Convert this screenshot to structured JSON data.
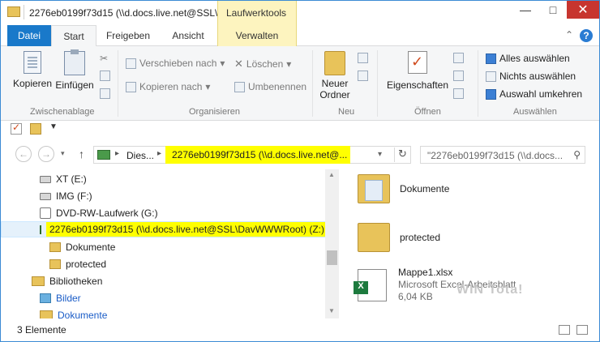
{
  "window": {
    "title": "2276eb0199f73d15 (\\\\d.docs.live.net@SSL\\...",
    "context_tab_header": "Laufwerktools",
    "accent": "#1979ca",
    "highlight": "#ffff00"
  },
  "tabs": [
    {
      "label": "Datei"
    },
    {
      "label": "Start"
    },
    {
      "label": "Freigeben"
    },
    {
      "label": "Ansicht"
    },
    {
      "label": "Verwalten"
    }
  ],
  "ribbon": {
    "clipboard": {
      "copy": "Kopieren",
      "paste": "Einfügen",
      "label": "Zwischenablage"
    },
    "organize": {
      "move": "Verschieben nach",
      "copy_to": "Kopieren nach",
      "delete": "Löschen",
      "rename": "Umbenennen",
      "label": "Organisieren"
    },
    "new": {
      "new_folder_line1": "Neuer",
      "new_folder_line2": "Ordner",
      "label": "Neu"
    },
    "open": {
      "properties": "Eigenschaften",
      "label": "Öffnen"
    },
    "select": {
      "all": "Alles auswählen",
      "none": "Nichts auswählen",
      "invert": "Auswahl umkehren",
      "label": "Auswählen"
    }
  },
  "address": {
    "segment1": "Dies...",
    "segment2": "2276eb0199f73d15 (\\\\d.docs.live.net@...",
    "search_placeholder": "\"2276eb0199f73d15 (\\\\d.docs..."
  },
  "nav_tree": [
    {
      "label": "XT (E:)",
      "icon": "drive-icon"
    },
    {
      "label": "IMG (F:)",
      "icon": "drive-icon"
    },
    {
      "label": "DVD-RW-Laufwerk (G:)",
      "icon": "dvd-drive-icon"
    },
    {
      "label": "2276eb0199f73d15 (\\\\d.docs.live.net@SSL\\DavWWWRoot) (Z:)",
      "icon": "network-drive-icon"
    },
    {
      "label": "Dokumente",
      "icon": "folder-icon"
    },
    {
      "label": "protected",
      "icon": "folder-icon"
    },
    {
      "label": "Bibliotheken",
      "icon": "library-icon"
    },
    {
      "label": "Bilder",
      "icon": "pictures-icon"
    },
    {
      "label": "Dokumente",
      "icon": "documents-icon"
    }
  ],
  "content_items": [
    {
      "name": "Dokumente",
      "icon": "folder-icon"
    },
    {
      "name": "protected",
      "icon": "folder-icon"
    },
    {
      "name": "Mappe1.xlsx",
      "type": "Microsoft Excel-Arbeitsblatt",
      "size": "6,04 KB",
      "icon": "excel-file-icon"
    }
  ],
  "watermark": "WIN Tota!",
  "status": {
    "count": "3 Elemente"
  }
}
